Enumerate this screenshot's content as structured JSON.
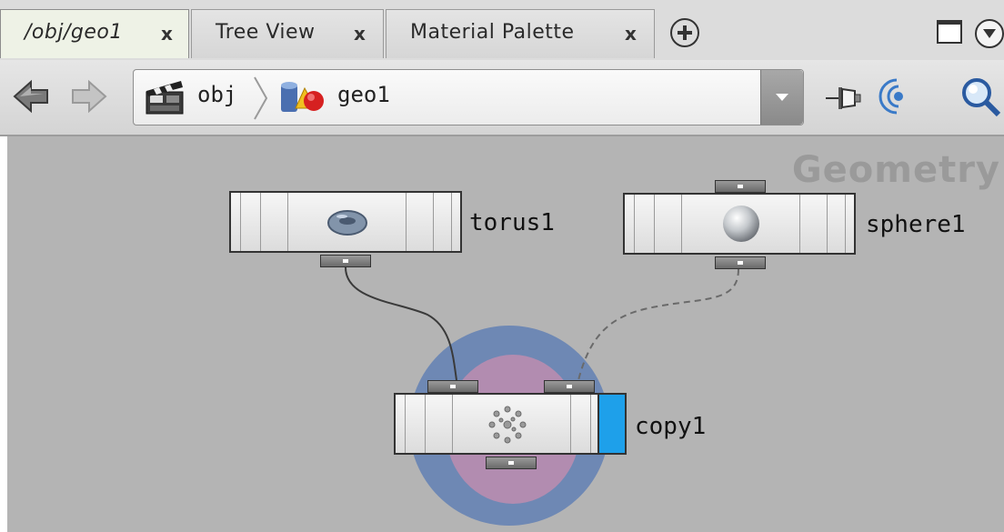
{
  "tabs": [
    {
      "label": "/obj/geo1",
      "close": "x",
      "active": true
    },
    {
      "label": "Tree View",
      "close": "x",
      "active": false
    },
    {
      "label": "Material Palette",
      "close": "x",
      "active": false
    }
  ],
  "pathbar": {
    "crumbs": [
      "obj",
      "geo1"
    ]
  },
  "network": {
    "context_label": "Geometry",
    "nodes": [
      {
        "name": "torus1",
        "type_icon": "torus-icon"
      },
      {
        "name": "sphere1",
        "type_icon": "sphere-icon"
      },
      {
        "name": "copy1",
        "type_icon": "copy-icon",
        "display_flag": true,
        "selected": true
      }
    ]
  },
  "colors": {
    "display_flag": "#1ea0ea",
    "selection_outer": "#6e88b4",
    "selection_inner": "#b28cb0",
    "canvas": "#b4b4b4"
  }
}
